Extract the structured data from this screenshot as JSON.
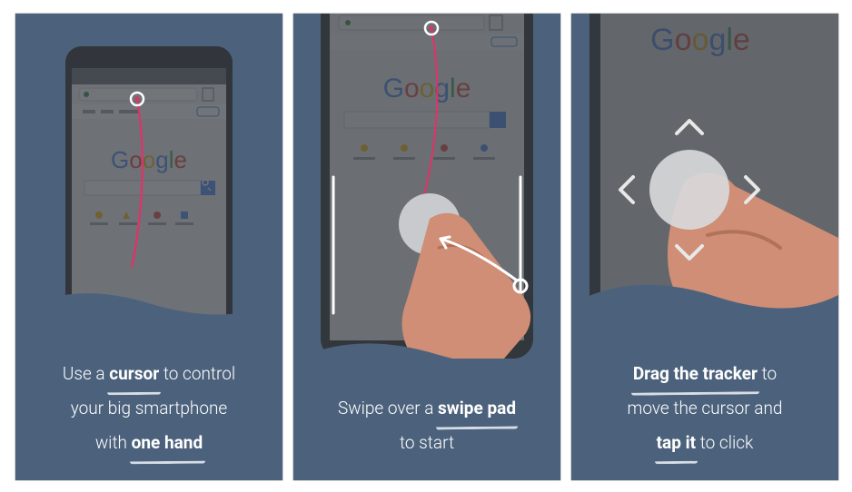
{
  "slides": [
    {
      "id": "slide-cursor",
      "caption_parts": {
        "pre1": "Use a ",
        "bold1": "cursor",
        "mid1": " to control",
        "line2": "your big smartphone",
        "pre3": "with ",
        "bold3": "one hand"
      },
      "phone_logo": "Google",
      "interactable": false
    },
    {
      "id": "slide-swipe",
      "caption_parts": {
        "pre1": "Swipe over a ",
        "bold1": "swipe pad",
        "line2": "to start"
      },
      "phone_logo": "Google",
      "interactable": false
    },
    {
      "id": "slide-drag",
      "caption_parts": {
        "bold1": "Drag the tracker",
        "post1": " to",
        "line2": "move the cursor and",
        "bold3": "tap it",
        "post3": " to click"
      },
      "phone_logo": "Google",
      "interactable": false
    }
  ],
  "colors": {
    "bg": "#4c627c",
    "phone_body": "#3a3f45",
    "phone_screen_tint": "rgba(80,85,92,0.85)",
    "accent_pink": "#e33167",
    "hand": "#cf8e75",
    "hand_shadow": "#b07258",
    "tracker": "#cfd3d7",
    "arrow": "#e8e8e8",
    "text": "#ffffff"
  }
}
